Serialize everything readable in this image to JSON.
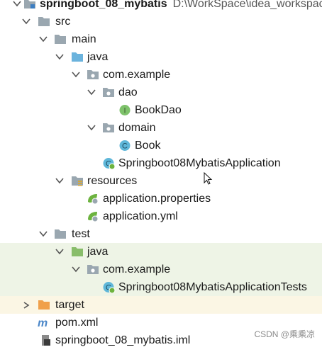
{
  "project_tree": {
    "root_name": "springboot_08_mybatis",
    "root_path": "D:\\WorkSpace\\idea_workspac",
    "src_label": "src",
    "main_label": "main",
    "main_java_label": "java",
    "main_package_label": "com.example",
    "dao_label": "dao",
    "book_dao_label": "BookDao",
    "domain_label": "domain",
    "book_label": "Book",
    "app_class_label": "Springboot08MybatisApplication",
    "resources_label": "resources",
    "app_properties_label": "application.properties",
    "app_yml_label": "application.yml",
    "test_label": "test",
    "test_java_label": "java",
    "test_package_label": "com.example",
    "test_class_label": "Springboot08MybatisApplicationTests",
    "target_label": "target",
    "pom_label": "pom.xml",
    "iml_label": "springboot_08_mybatis.iml"
  },
  "watermark": "CSDN @乘乘凉",
  "colors": {
    "selected_row": "#eef4e6",
    "target_row": "#fbf6e4",
    "folder_gray": "#9aa7b0",
    "source_folder_blue": "#6bb3dd",
    "test_folder_green": "#88bd6a",
    "target_folder_orange": "#f0a04b",
    "interface_green": "#7ec26b",
    "class_blue": "#5fb7d9"
  },
  "icons": {
    "collapse": "chevron-down-icon",
    "expand": "chevron-right-icon",
    "module": "module-folder-icon",
    "folder": "folder-icon",
    "package": "package-icon",
    "interface": "interface-icon",
    "class": "class-icon",
    "spring_boot": "spring-boot-app-icon",
    "spring_config": "spring-config-icon",
    "maven": "maven-icon",
    "iml": "iml-file-icon"
  }
}
